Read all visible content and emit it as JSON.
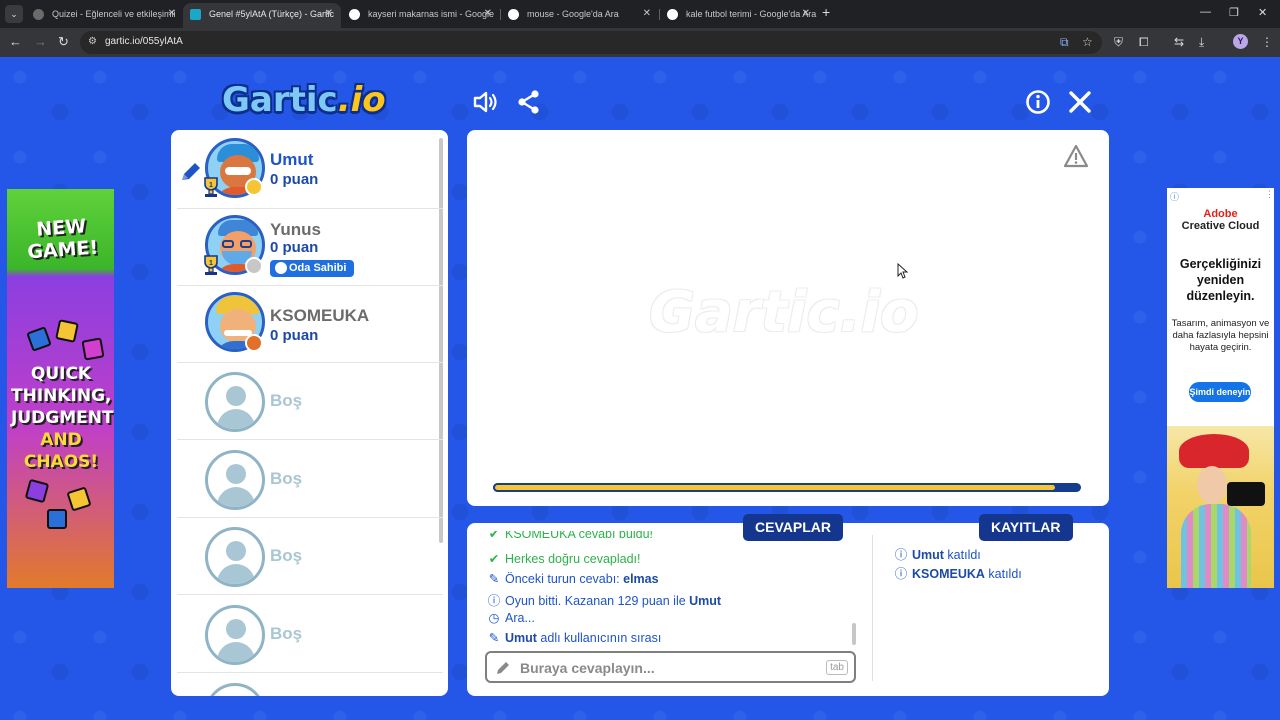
{
  "browser": {
    "tabs": [
      {
        "title": "Quizei - Eğlenceli ve etkileşimli",
        "active": false,
        "favicon_color": "#6b6b6b"
      },
      {
        "title": "Genel #5ylAtA (Türkçe) - Gartic",
        "active": true,
        "favicon_color": "#1aa7c8"
      },
      {
        "title": "kayseri makarnas ismi - Google",
        "active": false,
        "favicon_color": "#ffffff"
      },
      {
        "title": "mouse - Google'da Ara",
        "active": false,
        "favicon_color": "#ffffff"
      },
      {
        "title": "kale futbol terimi - Google'da Ara",
        "active": false,
        "favicon_color": "#ffffff"
      }
    ],
    "url": "gartic.io/055ylAtA"
  },
  "logo": {
    "main": "Gartic",
    "suffix": ".io"
  },
  "players": [
    {
      "name": "Umut",
      "score": "0 puan",
      "status_color": "#f5c534",
      "drawing": true,
      "owner": false,
      "trophy": true,
      "name_color": "#1e54c8",
      "skin": "#d9773f",
      "hat": "#2a8fd8"
    },
    {
      "name": "Yunus",
      "score": "0 puan",
      "status_color": "#c7c7c7",
      "drawing": false,
      "owner": true,
      "trophy": true,
      "name_color": "#6b6b6b",
      "skin": "#f2a067",
      "hat": "#3f86d8"
    },
    {
      "name": "KSOMEUKA",
      "score": "0 puan",
      "status_color": "#e0702a",
      "drawing": false,
      "owner": false,
      "trophy": false,
      "name_color": "#6b6b6b",
      "skin": "#f0b27a",
      "hat": "#f0c43a"
    }
  ],
  "owner_badge": "Oda Sahibi",
  "empty_slot_label": "Boş",
  "empty_slots": 4,
  "canvas": {
    "watermark": "Gartic.io",
    "timer_progress": 0.96
  },
  "answers": {
    "tab_label": "CEVAPLAR",
    "cut_message": "KSOMEUKA cevabı buldu!",
    "messages": [
      {
        "icon": "check",
        "text": "Herkes doğru cevapladı!",
        "style": "green",
        "bold": ""
      },
      {
        "icon": "pencil",
        "text": "Önceki turun cevabı: ",
        "style": "blue",
        "bold": "elmas",
        "after": ""
      },
      {
        "icon": "info",
        "text": "Oyun bitti. Kazanan 129 puan ile ",
        "style": "blue",
        "bold": "Umut",
        "after": ""
      },
      {
        "icon": "clock",
        "text": "Ara...",
        "style": "blue",
        "bold": ""
      },
      {
        "icon": "pencil",
        "text": "",
        "style": "blue",
        "bold": "Umut",
        "after": " adlı kullanıcının sırası"
      }
    ],
    "placeholder": "Buraya cevaplayın...",
    "tab_hint": "tab"
  },
  "logs": {
    "tab_label": "KAYITLAR",
    "messages": [
      {
        "name": "Umut",
        "text": " katıldı"
      },
      {
        "name": "KSOMEUKA",
        "text": " katıldı"
      }
    ]
  },
  "ads": {
    "left": {
      "title": "NEW GAME!",
      "line1": "QUICK",
      "line2": "THINKING,",
      "line3": "JUDGMENT",
      "line4": "AND",
      "line5": "CHAOS!"
    },
    "right": {
      "brand1": "Adobe",
      "brand2": "Creative Cloud",
      "headline": "Gerçekliğinizi yeniden düzenleyin.",
      "sub": "Tasarım, animasyon ve daha fazlasıyla hepsini hayata geçirin.",
      "cta": "Şimdi deneyin"
    }
  }
}
